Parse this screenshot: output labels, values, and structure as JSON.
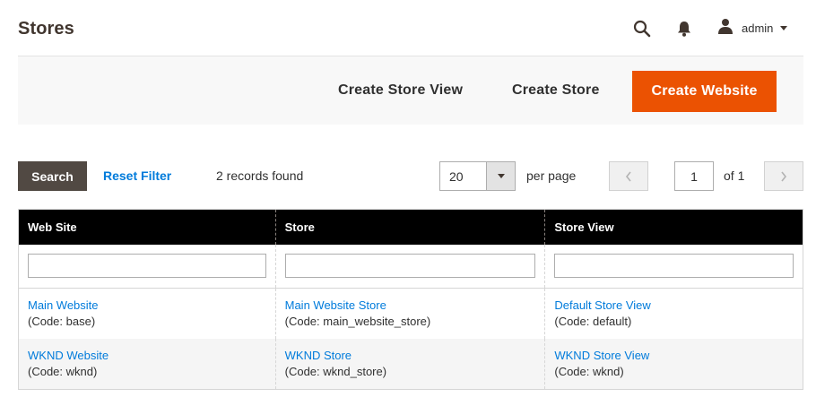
{
  "header": {
    "title": "Stores",
    "user_name": "admin"
  },
  "actions": {
    "create_store_view": "Create Store View",
    "create_store": "Create Store",
    "create_website": "Create Website"
  },
  "toolbar": {
    "search_label": "Search",
    "reset_label": "Reset Filter",
    "records": "2 records found",
    "per_page_value": "20",
    "per_page_label": "per page",
    "current_page": "1",
    "of_pages": "of 1"
  },
  "grid": {
    "columns": [
      "Web Site",
      "Store",
      "Store View"
    ],
    "rows": [
      {
        "website": "Main Website",
        "website_code": "(Code: base)",
        "store": "Main Website Store",
        "store_code": "(Code: main_website_store)",
        "view": "Default Store View",
        "view_code": "(Code: default)"
      },
      {
        "website": "WKND Website",
        "website_code": "(Code: wknd)",
        "store": "WKND Store",
        "store_code": "(Code: wknd_store)",
        "view": "WKND Store View",
        "view_code": "(Code: wknd)"
      }
    ]
  },
  "colors": {
    "accent": "#eb5202",
    "link": "#007bdb",
    "header_bg": "#000000",
    "search_button": "#514943"
  },
  "icons": {
    "search": "search-icon",
    "notifications": "bell-icon",
    "user": "user-icon"
  }
}
